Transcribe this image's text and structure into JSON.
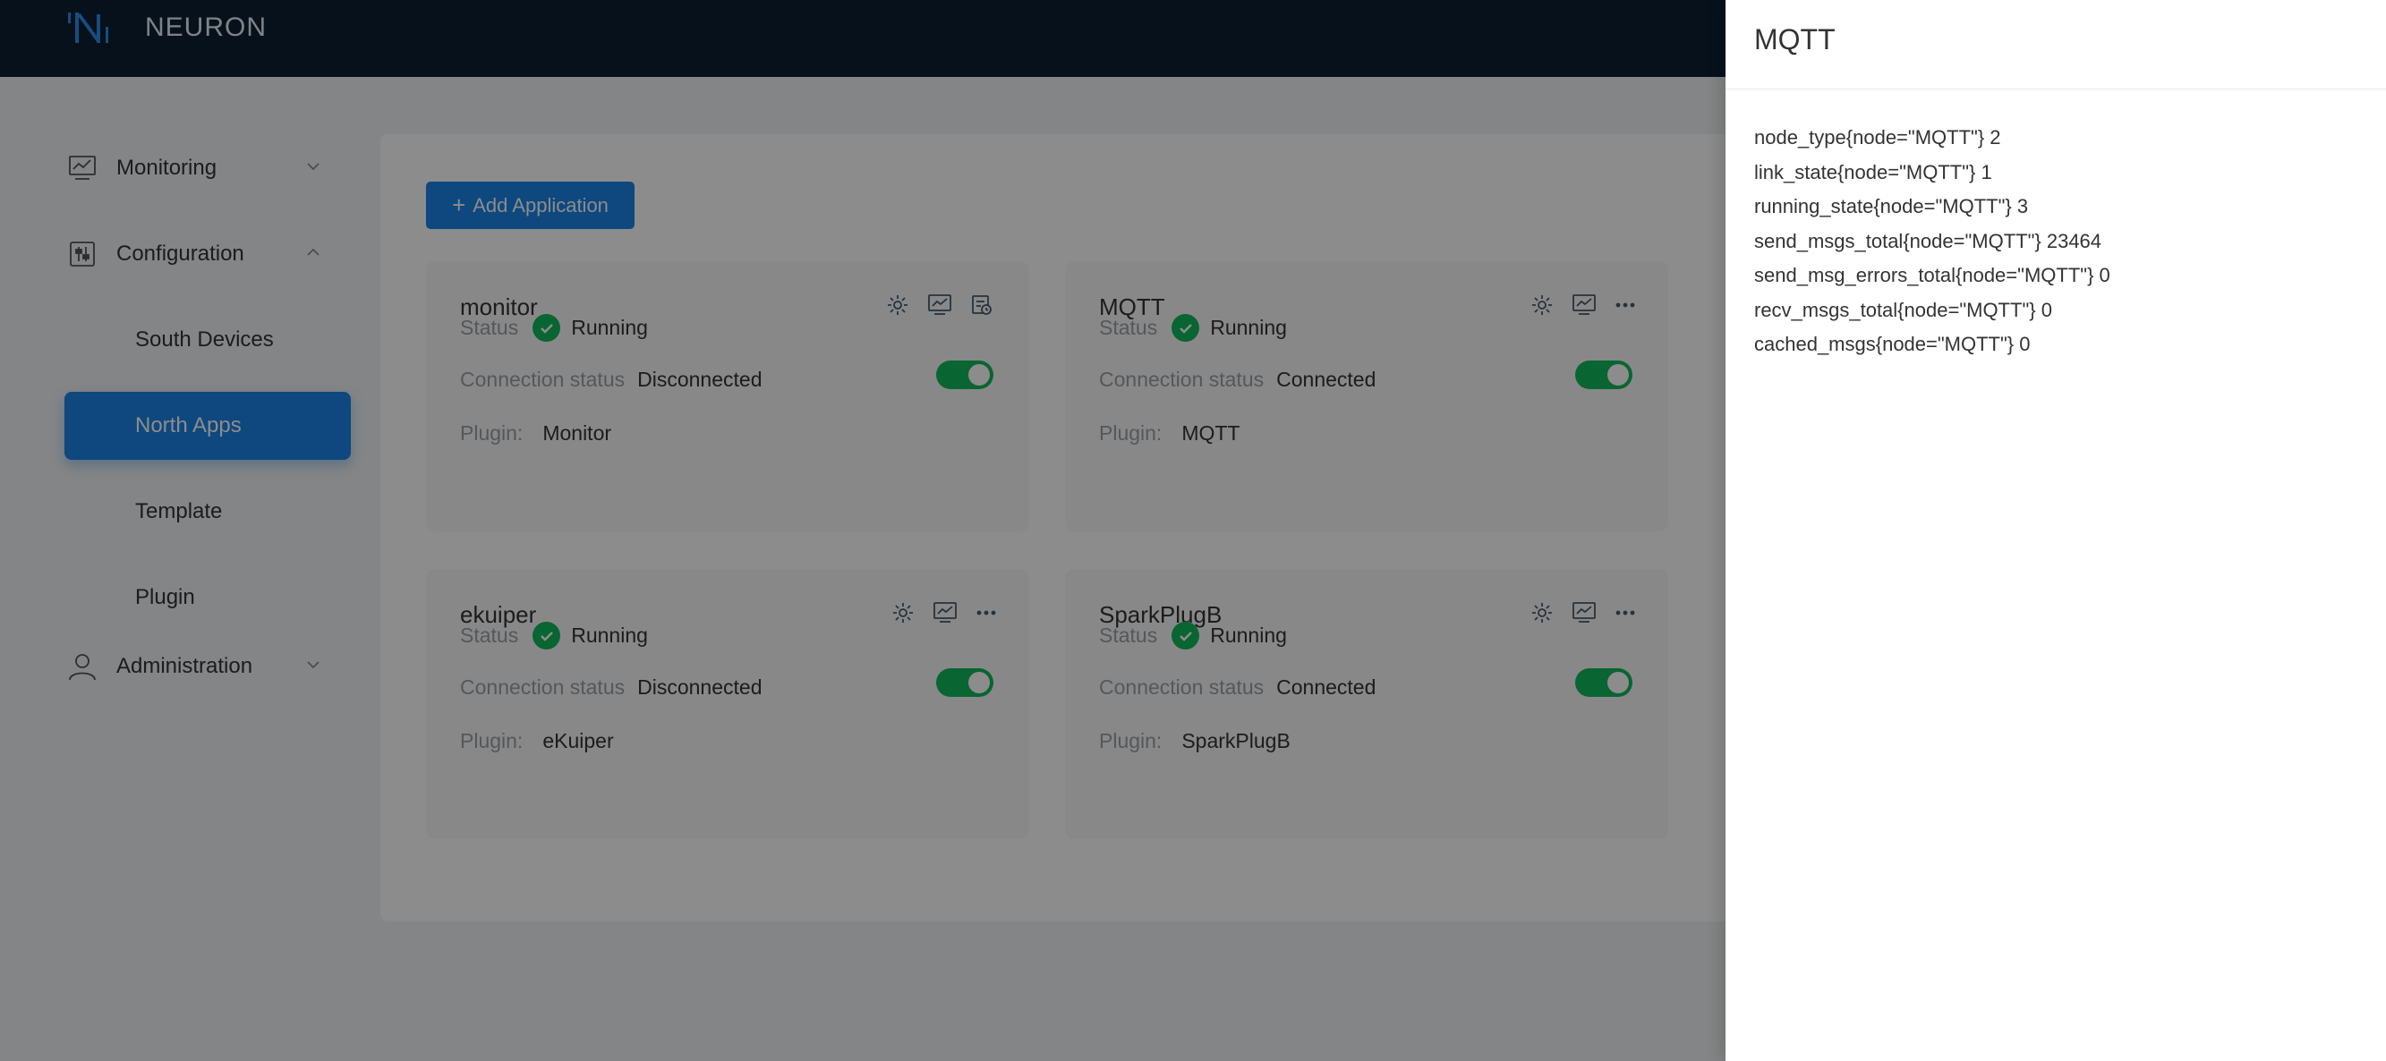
{
  "app": {
    "name": "NEURON"
  },
  "colors": {
    "primary": "#1a84e6",
    "header": "#0b1f33",
    "running": "#12b85a"
  },
  "sidebar": {
    "monitoring": {
      "label": "Monitoring",
      "icon": "chart-icon"
    },
    "configuration": {
      "label": "Configuration",
      "icon": "sliders-icon",
      "items": [
        {
          "label": "South Devices"
        },
        {
          "label": "North Apps",
          "active": true
        },
        {
          "label": "Template"
        },
        {
          "label": "Plugin"
        }
      ]
    },
    "administration": {
      "label": "Administration",
      "icon": "user-icon"
    }
  },
  "toolbar": {
    "add_label": "Add Application"
  },
  "cards": [
    {
      "title": "monitor",
      "status_label": "Status",
      "status": "Running",
      "enabled": true,
      "conn_label": "Connection status",
      "conn": "Disconnected",
      "plugin_label": "Plugin:",
      "plugin": "Monitor"
    },
    {
      "title": "MQTT",
      "status_label": "Status",
      "status": "Running",
      "enabled": true,
      "conn_label": "Connection status",
      "conn": "Connected",
      "plugin_label": "Plugin:",
      "plugin": "MQTT"
    },
    {
      "title": "ekuiper",
      "status_label": "Status",
      "status": "Running",
      "enabled": true,
      "conn_label": "Connection status",
      "conn": "Disconnected",
      "plugin_label": "Plugin:",
      "plugin": "eKuiper"
    },
    {
      "title": "SparkPlugB",
      "status_label": "Status",
      "status": "Running",
      "enabled": true,
      "conn_label": "Connection status",
      "conn": "Connected",
      "plugin_label": "Plugin:",
      "plugin": "SparkPlugB"
    }
  ],
  "drawer": {
    "title": "MQTT",
    "metrics": [
      "node_type{node=\"MQTT\"} 2",
      "link_state{node=\"MQTT\"} 1",
      "running_state{node=\"MQTT\"} 3",
      "send_msgs_total{node=\"MQTT\"} 23464",
      "send_msg_errors_total{node=\"MQTT\"} 0",
      "recv_msgs_total{node=\"MQTT\"} 0",
      "cached_msgs{node=\"MQTT\"} 0"
    ]
  }
}
